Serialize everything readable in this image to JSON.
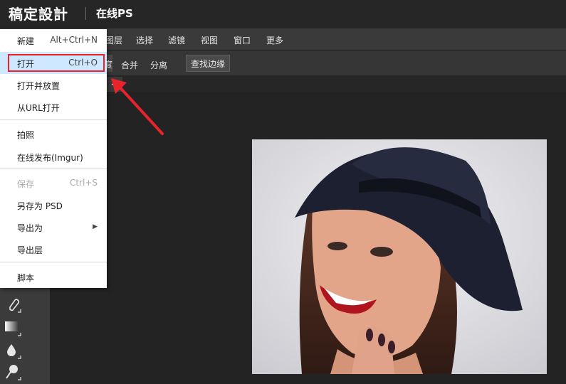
{
  "header": {
    "logo": "稿定設計",
    "app_title": "在线PS"
  },
  "menubar": {
    "items": [
      "图层",
      "选择",
      "滤镜",
      "视图",
      "窗口",
      "更多"
    ]
  },
  "options": {
    "stub": "度",
    "merge": "合并",
    "separate": "分离",
    "find_edges": "查找边缘"
  },
  "tab": {
    "close": "×"
  },
  "file_menu": {
    "new": {
      "label": "新建",
      "shortcut": "Alt+Ctrl+N"
    },
    "open": {
      "label": "打开",
      "shortcut": "Ctrl+O"
    },
    "open_place": {
      "label": "打开并放置"
    },
    "open_url": {
      "label": "从URL打开"
    },
    "capture": {
      "label": "拍照"
    },
    "publish": {
      "label": "在线发布(Imgur)"
    },
    "save": {
      "label": "保存",
      "shortcut": "Ctrl+S"
    },
    "save_psd": {
      "label": "另存为 PSD"
    },
    "export_as": {
      "label": "导出为",
      "arrow": "▶"
    },
    "export_layers": {
      "label": "导出层"
    },
    "script": {
      "label": "脚本"
    }
  },
  "colors": {
    "highlight_border": "#e8232a",
    "arrow": "#e8232a",
    "menu_hover": "#cfe8ff"
  },
  "icons": [
    "eraser-icon",
    "gradient-icon",
    "blur-icon",
    "dodge-icon"
  ]
}
